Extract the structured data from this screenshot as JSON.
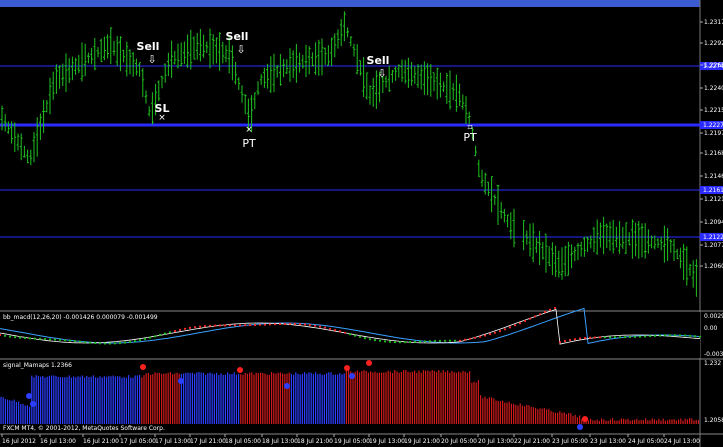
{
  "window": {
    "title": ""
  },
  "main": {
    "price_levels": [
      "1.23170",
      "1.22925",
      "1.22655",
      "1.22405",
      "1.22155",
      "1.21970",
      "1.21680",
      "1.21460",
      "1.21210",
      "1.20945",
      "1.20775",
      "1.20605"
    ],
    "price_tags": [
      "1.22749",
      "1.22277",
      "1.21618",
      "1.21221"
    ],
    "annotations": [
      {
        "text": "Sell",
        "arrow": "⇩"
      },
      {
        "text": "SL",
        "marker": "×"
      },
      {
        "text": "Sell",
        "arrow": "⇩"
      },
      {
        "text": "PT",
        "marker": "×"
      },
      {
        "text": "Sell",
        "arrow": "⇩"
      },
      {
        "text": "PT",
        "marker": "⌗"
      }
    ],
    "bar_color": "#1fc21f",
    "line_color": "#2b2bff"
  },
  "macd_pane": {
    "title": "bb_macd(12,26,20) -0.001426 0.000079 -0.001499",
    "levels": [
      "0.00294",
      "0.00",
      "-0.00348"
    ]
  },
  "signal_pane": {
    "title": "signal_Mamaps 1.2366",
    "levels": [
      "1.232",
      "1.2058"
    ]
  },
  "time_axis": [
    "16 Jul 2012",
    "16 Jul 13:00",
    "16 Jul 21:00",
    "17 Jul 05:00",
    "17 Jul 13:00",
    "17 Jul 21:00",
    "18 Jul 05:00",
    "18 Jul 13:00",
    "18 Jul 21:00",
    "19 Jul 05:00",
    "19 Jul 13:00",
    "19 Jul 21:00",
    "20 Jul 05:00",
    "20 Jul 13:00",
    "22 Jul 21:00",
    "23 Jul 05:00",
    "23 Jul 13:00",
    "24 Jul 05:00",
    "24 Jul 13:00"
  ],
  "footer": {
    "copyright": "FXCM MT4, © 2001-2012, MetaQuotes Software Corp."
  }
}
